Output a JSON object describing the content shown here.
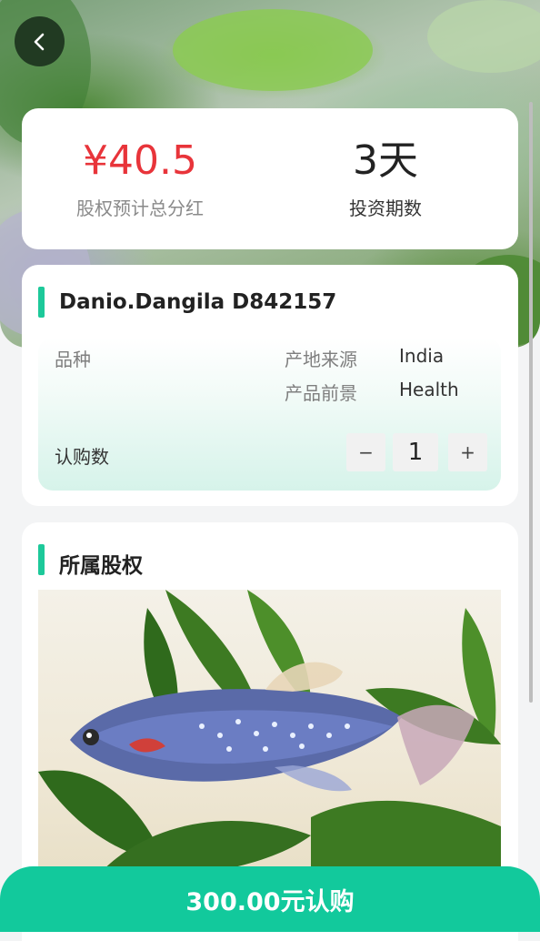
{
  "summary": {
    "dividend_value": "¥40.5",
    "dividend_label": "股权预计总分红",
    "period_value": "3天",
    "period_label": "投资期数"
  },
  "product": {
    "name_line": "Danio.Dangila   D842157",
    "species_label": "品种",
    "origin_label": "产地来源",
    "origin_value": "India",
    "outlook_label": "产品前景",
    "outlook_value": "Health",
    "quantity_label": "认购数",
    "decrement": "−",
    "quantity_value": "1",
    "increment": "+"
  },
  "equity": {
    "title": "所属股权"
  },
  "action": {
    "buy_label": "300.00元认购"
  },
  "colors": {
    "accent": "#12c99c",
    "price": "#e8343a"
  },
  "icons": {
    "back": "chevron-left-icon"
  }
}
